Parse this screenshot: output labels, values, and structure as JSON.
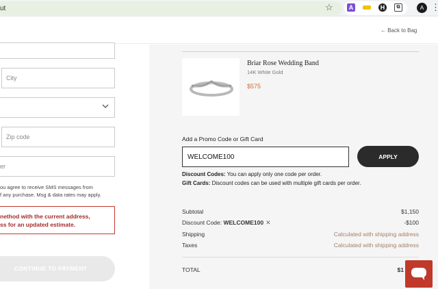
{
  "browser": {
    "url_fragment": "ut",
    "star_icon": "☆",
    "ext_a_label": "A",
    "ext_h_label": "H",
    "ext_p_label": "⧉",
    "avatar_label": "A",
    "menu_icon": "⋮"
  },
  "header": {
    "back_link": "← Back to Bag"
  },
  "form": {
    "city_placeholder": "City",
    "zip_placeholder": "Zip code",
    "phone_placeholder_fragment": "er",
    "sms_line1": "ou agree to receive SMS messages from",
    "sms_line2": "f any purchase. Msg & data rates may apply.",
    "error_line1": "nethod with the current address,",
    "error_line2": "ss for an updated estimate.",
    "continue_button": "CONTINUE TO PAYMENT"
  },
  "product": {
    "name": "Briar Rose Wedding Band",
    "variant": "14K White Gold",
    "price": "$575"
  },
  "promo": {
    "label": "Add a Promo Code or Gift Card",
    "input_value": "WELCOME100",
    "apply_button": "APPLY",
    "discount_note_title": "Discount Codes:",
    "discount_note_text": " You can apply only one code per order.",
    "gift_note_title": "Gift Cards:",
    "gift_note_text": " Discount codes can be used with multiple gift cards per order."
  },
  "summary": {
    "subtotal_label": "Subtotal",
    "subtotal_value": "$1,150",
    "discount_label": "Discount Code: ",
    "discount_code": "WELCOME100",
    "remove_icon": "✕",
    "discount_value": "-$100",
    "shipping_label": "Shipping",
    "shipping_value": "Calculated with shipping address",
    "taxes_label": "Taxes",
    "taxes_value": "Calculated with shipping address",
    "total_label": "TOTAL",
    "total_value_fragment": "$1"
  },
  "colors": {
    "accent_price": "#d46a30",
    "error": "#c0392b",
    "chat": "#c0392b"
  }
}
